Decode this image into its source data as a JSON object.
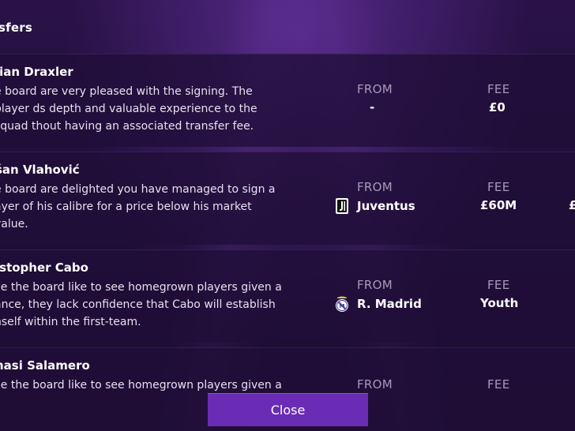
{
  "section": {
    "title": "sfers"
  },
  "columns": {
    "from": "FROM",
    "fee": "FEE"
  },
  "transfers": [
    {
      "name": "lian Draxler",
      "comment": "e board are very pleased with the signing. The player ds depth and valuable experience to the squad thout having an associated transfer fee.",
      "from": "-",
      "fee": "£0"
    },
    {
      "name": "šan Vlahović",
      "comment": "e board are delighted you have managed to sign a ayer of his calibre for a price below his market value.",
      "from_club": "Juventus",
      "from_crest_icon": "juventus-crest-icon",
      "fee": "£60M",
      "extra": "£"
    },
    {
      "name": "istopher Cabo",
      "comment": "ile the board like to see homegrown players given a ance, they lack confidence that Cabo will establish nself within the first-team.",
      "from_club": "R. Madrid",
      "from_crest_icon": "real-madrid-crest-icon",
      "fee": "Youth"
    },
    {
      "name": "nasi Salamero",
      "comment": "ile the board like to see homegrown players given a"
    }
  ],
  "footer": {
    "close_label": "Close"
  },
  "colors": {
    "background": "#1f0e38",
    "row": "#200e38",
    "button": "#6a2bb5",
    "label": "#a79ab8"
  }
}
